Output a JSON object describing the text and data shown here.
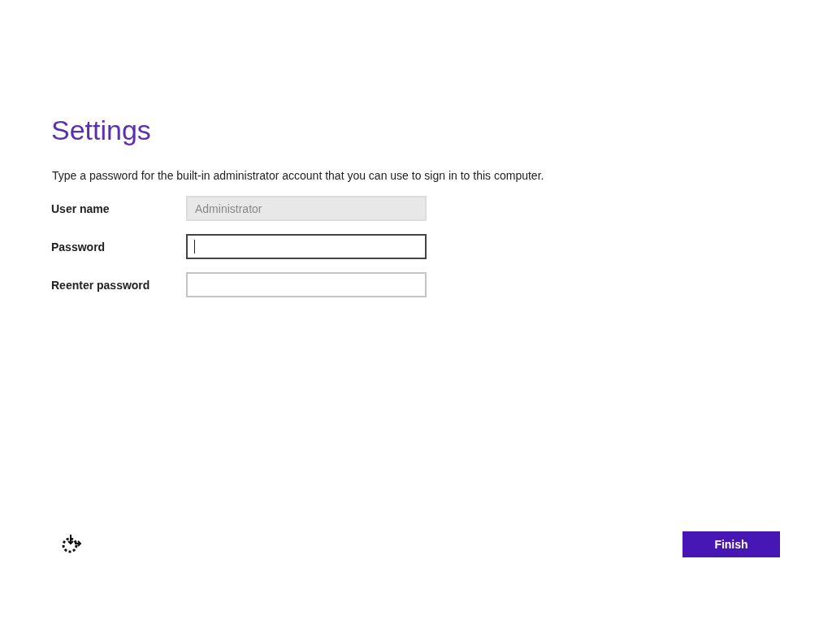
{
  "title": "Settings",
  "description": "Type a password for the built-in administrator account that you can use to sign in to this computer.",
  "fields": [
    {
      "label": "User name",
      "value": "Administrator",
      "disabled": true,
      "focused": false
    },
    {
      "label": "Password",
      "disabled": false,
      "focused": true
    },
    {
      "label": "Reenter password",
      "disabled": false,
      "focused": false
    }
  ],
  "finish_button": "Finish"
}
